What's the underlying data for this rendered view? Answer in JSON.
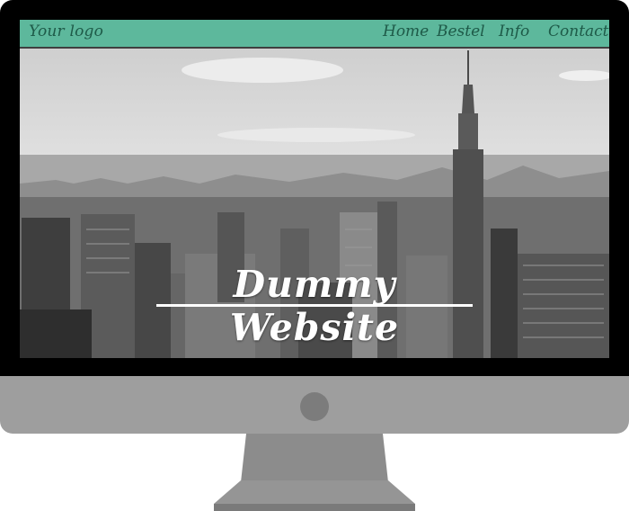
{
  "site": {
    "logo": "Your logo",
    "nav": [
      {
        "label": "Home"
      },
      {
        "label": "Bestel"
      },
      {
        "label": "Info"
      },
      {
        "label": "Contact"
      }
    ],
    "hero_title": "Dummy Website"
  },
  "colors": {
    "navbar": "#5db89c",
    "nav_text": "#1e5a48",
    "bezel": "#000000",
    "chin": "#9e9e9e",
    "stand": "#8a8a8a"
  },
  "icons": {
    "camera": "webcam-icon"
  }
}
